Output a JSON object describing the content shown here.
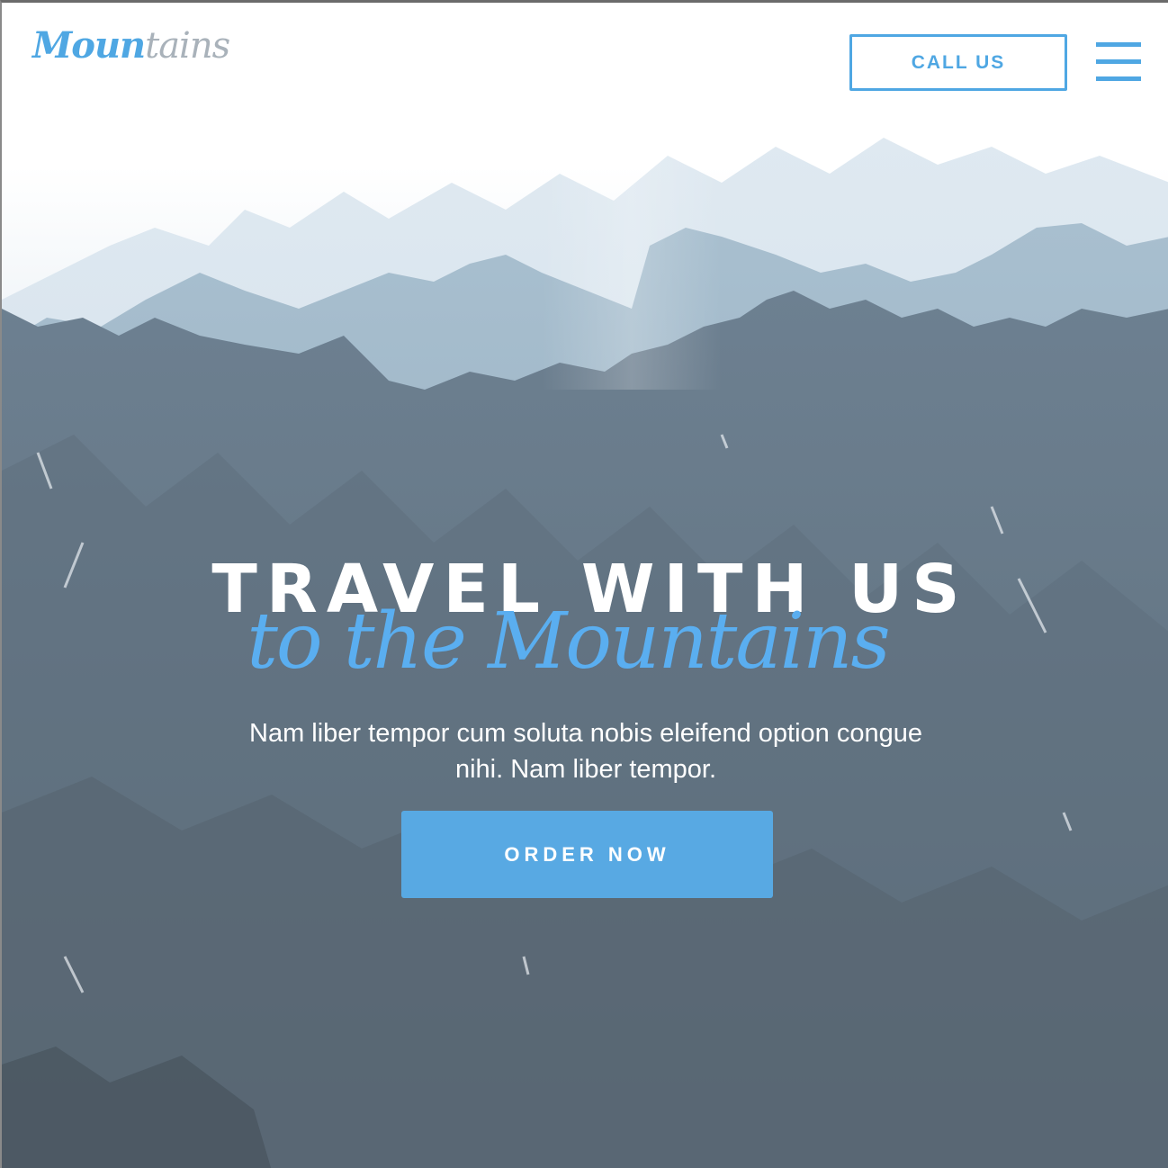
{
  "header": {
    "logo": {
      "part1": "Moun",
      "part2": "tains"
    },
    "call_label": "CALL US"
  },
  "hero": {
    "title": "TRAVEL WITH US",
    "script": "to the Mountains",
    "description_line1": "Nam liber tempor cum soluta nobis eleifend option congue",
    "description_line2": "nihi. Nam liber tempor.",
    "order_label": "ORDER NOW"
  },
  "colors": {
    "accent": "#4fa7e3",
    "button": "#58a9e3",
    "text": "#ffffff"
  },
  "icons": {
    "menu": "hamburger-menu-icon"
  }
}
